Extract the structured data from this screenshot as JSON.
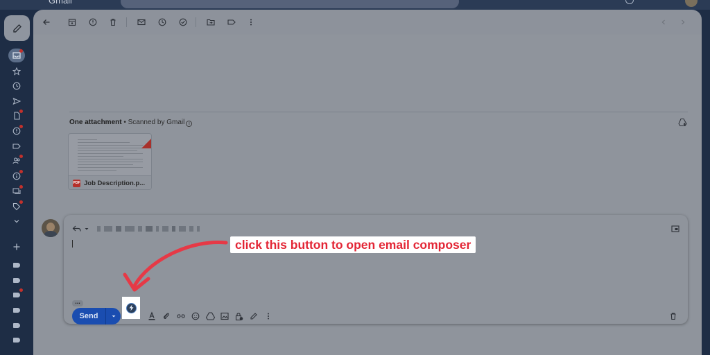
{
  "topbar": {
    "app_name": "Gmail"
  },
  "attachments": {
    "title": "One attachment",
    "scanned_text": " • Scanned by Gmail",
    "file_name": "Job Description.p..."
  },
  "reply": {
    "send_label": "Send",
    "recipients_hidden": true
  },
  "annotation": {
    "callout_text": "click this button to open email composer"
  },
  "colors": {
    "send": "#1a4db0",
    "annotation": "#e32636",
    "unread_dot": "#c2312c"
  },
  "icons": {
    "rail": [
      "inbox-icon",
      "star-icon",
      "clock-icon",
      "send-icon",
      "draft-icon",
      "important-icon",
      "label-icon",
      "contacts-icon",
      "info-icon",
      "chat-icon",
      "tag-icon",
      "chevron-down-icon"
    ],
    "toolbar": [
      "back-icon",
      "archive-icon",
      "report-icon",
      "delete-icon",
      "mail-icon",
      "snooze-icon",
      "task-icon",
      "move-icon",
      "label-icon",
      "more-icon"
    ]
  }
}
